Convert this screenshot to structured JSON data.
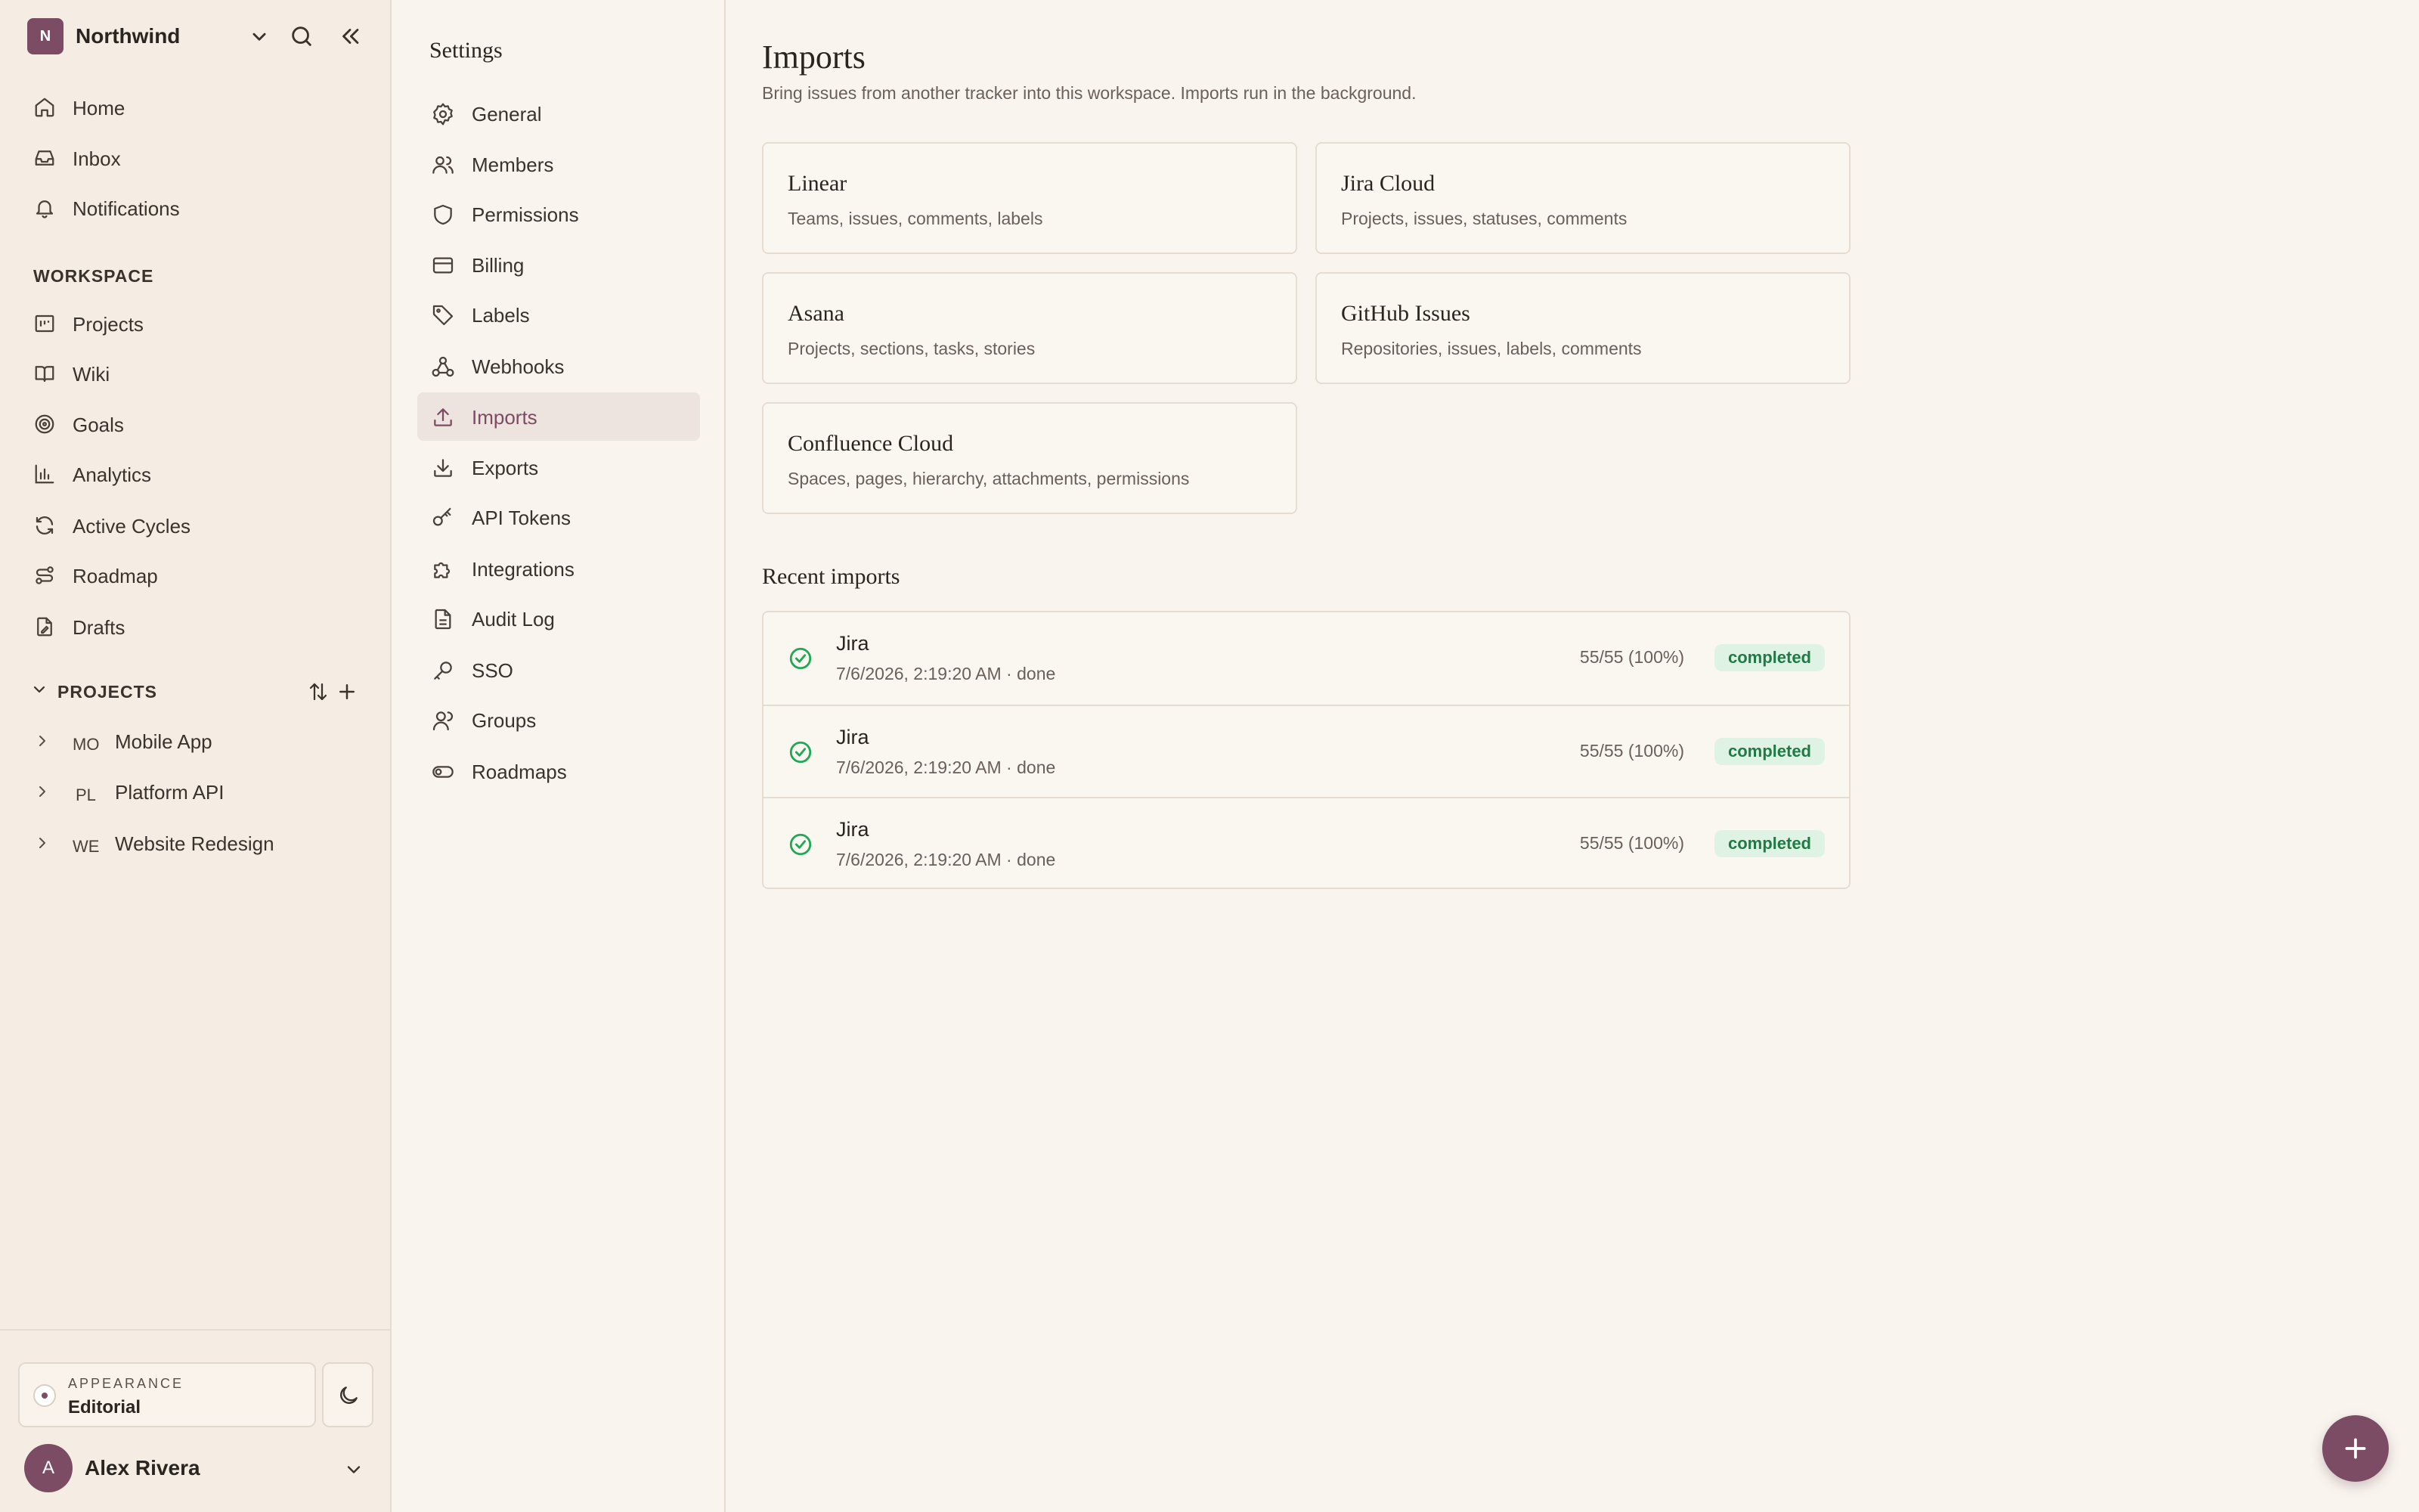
{
  "workspace": {
    "logo_letter": "N",
    "name": "Northwind"
  },
  "nav": {
    "items": [
      {
        "label": "Home",
        "icon": "home-icon"
      },
      {
        "label": "Inbox",
        "icon": "inbox-icon"
      },
      {
        "label": "Notifications",
        "icon": "bell-icon"
      }
    ],
    "workspace_label": "WORKSPACE",
    "workspace_items": [
      {
        "label": "Projects",
        "icon": "projects-icon"
      },
      {
        "label": "Wiki",
        "icon": "book-icon"
      },
      {
        "label": "Goals",
        "icon": "target-icon"
      },
      {
        "label": "Analytics",
        "icon": "bar-chart-icon"
      },
      {
        "label": "Active Cycles",
        "icon": "refresh-icon"
      },
      {
        "label": "Roadmap",
        "icon": "route-icon"
      },
      {
        "label": "Drafts",
        "icon": "draft-icon"
      }
    ],
    "projects_label": "PROJECTS",
    "projects": [
      {
        "code": "MO",
        "label": "Mobile App"
      },
      {
        "code": "PL",
        "label": "Platform API"
      },
      {
        "code": "WE",
        "label": "Website Redesign"
      }
    ]
  },
  "appearance": {
    "caption": "APPEARANCE",
    "value": "Editorial"
  },
  "user": {
    "initial": "A",
    "name": "Alex Rivera"
  },
  "settings": {
    "title": "Settings",
    "active": "Imports",
    "items": [
      {
        "label": "General",
        "icon": "gear-icon"
      },
      {
        "label": "Members",
        "icon": "users-icon"
      },
      {
        "label": "Permissions",
        "icon": "shield-icon"
      },
      {
        "label": "Billing",
        "icon": "credit-card-icon"
      },
      {
        "label": "Labels",
        "icon": "tag-icon"
      },
      {
        "label": "Webhooks",
        "icon": "webhook-icon"
      },
      {
        "label": "Imports",
        "icon": "upload-icon"
      },
      {
        "label": "Exports",
        "icon": "download-icon"
      },
      {
        "label": "API Tokens",
        "icon": "key-icon"
      },
      {
        "label": "Integrations",
        "icon": "puzzle-icon"
      },
      {
        "label": "Audit Log",
        "icon": "document-icon"
      },
      {
        "label": "SSO",
        "icon": "key-icon"
      },
      {
        "label": "Groups",
        "icon": "group-icon"
      },
      {
        "label": "Roadmaps",
        "icon": "toggle-icon"
      }
    ]
  },
  "main": {
    "title": "Imports",
    "subtitle": "Bring issues from another tracker into this workspace. Imports run in the background.",
    "sources": [
      {
        "name": "Linear",
        "desc": "Teams, issues, comments, labels"
      },
      {
        "name": "Jira Cloud",
        "desc": "Projects, issues, statuses, comments"
      },
      {
        "name": "Asana",
        "desc": "Projects, sections, tasks, stories"
      },
      {
        "name": "GitHub Issues",
        "desc": "Repositories, issues, labels, comments"
      },
      {
        "name": "Confluence Cloud",
        "desc": "Spaces, pages, hierarchy, attachments, permissions"
      }
    ],
    "recent_title": "Recent imports",
    "recent": [
      {
        "name": "Jira",
        "meta": "7/6/2026, 2:19:20 AM · done",
        "progress": "55/55 (100%)",
        "status": "completed"
      },
      {
        "name": "Jira",
        "meta": "7/6/2026, 2:19:20 AM · done",
        "progress": "55/55 (100%)",
        "status": "completed"
      },
      {
        "name": "Jira",
        "meta": "7/6/2026, 2:19:20 AM · done",
        "progress": "55/55 (100%)",
        "status": "completed"
      }
    ]
  },
  "colors": {
    "accent": "#7b4c64",
    "sidebar_bg": "#f5ede3",
    "page_bg": "#f9f5ee",
    "success": "#20a855",
    "badge_bg": "#dff3e5",
    "badge_text": "#1f7a45"
  }
}
